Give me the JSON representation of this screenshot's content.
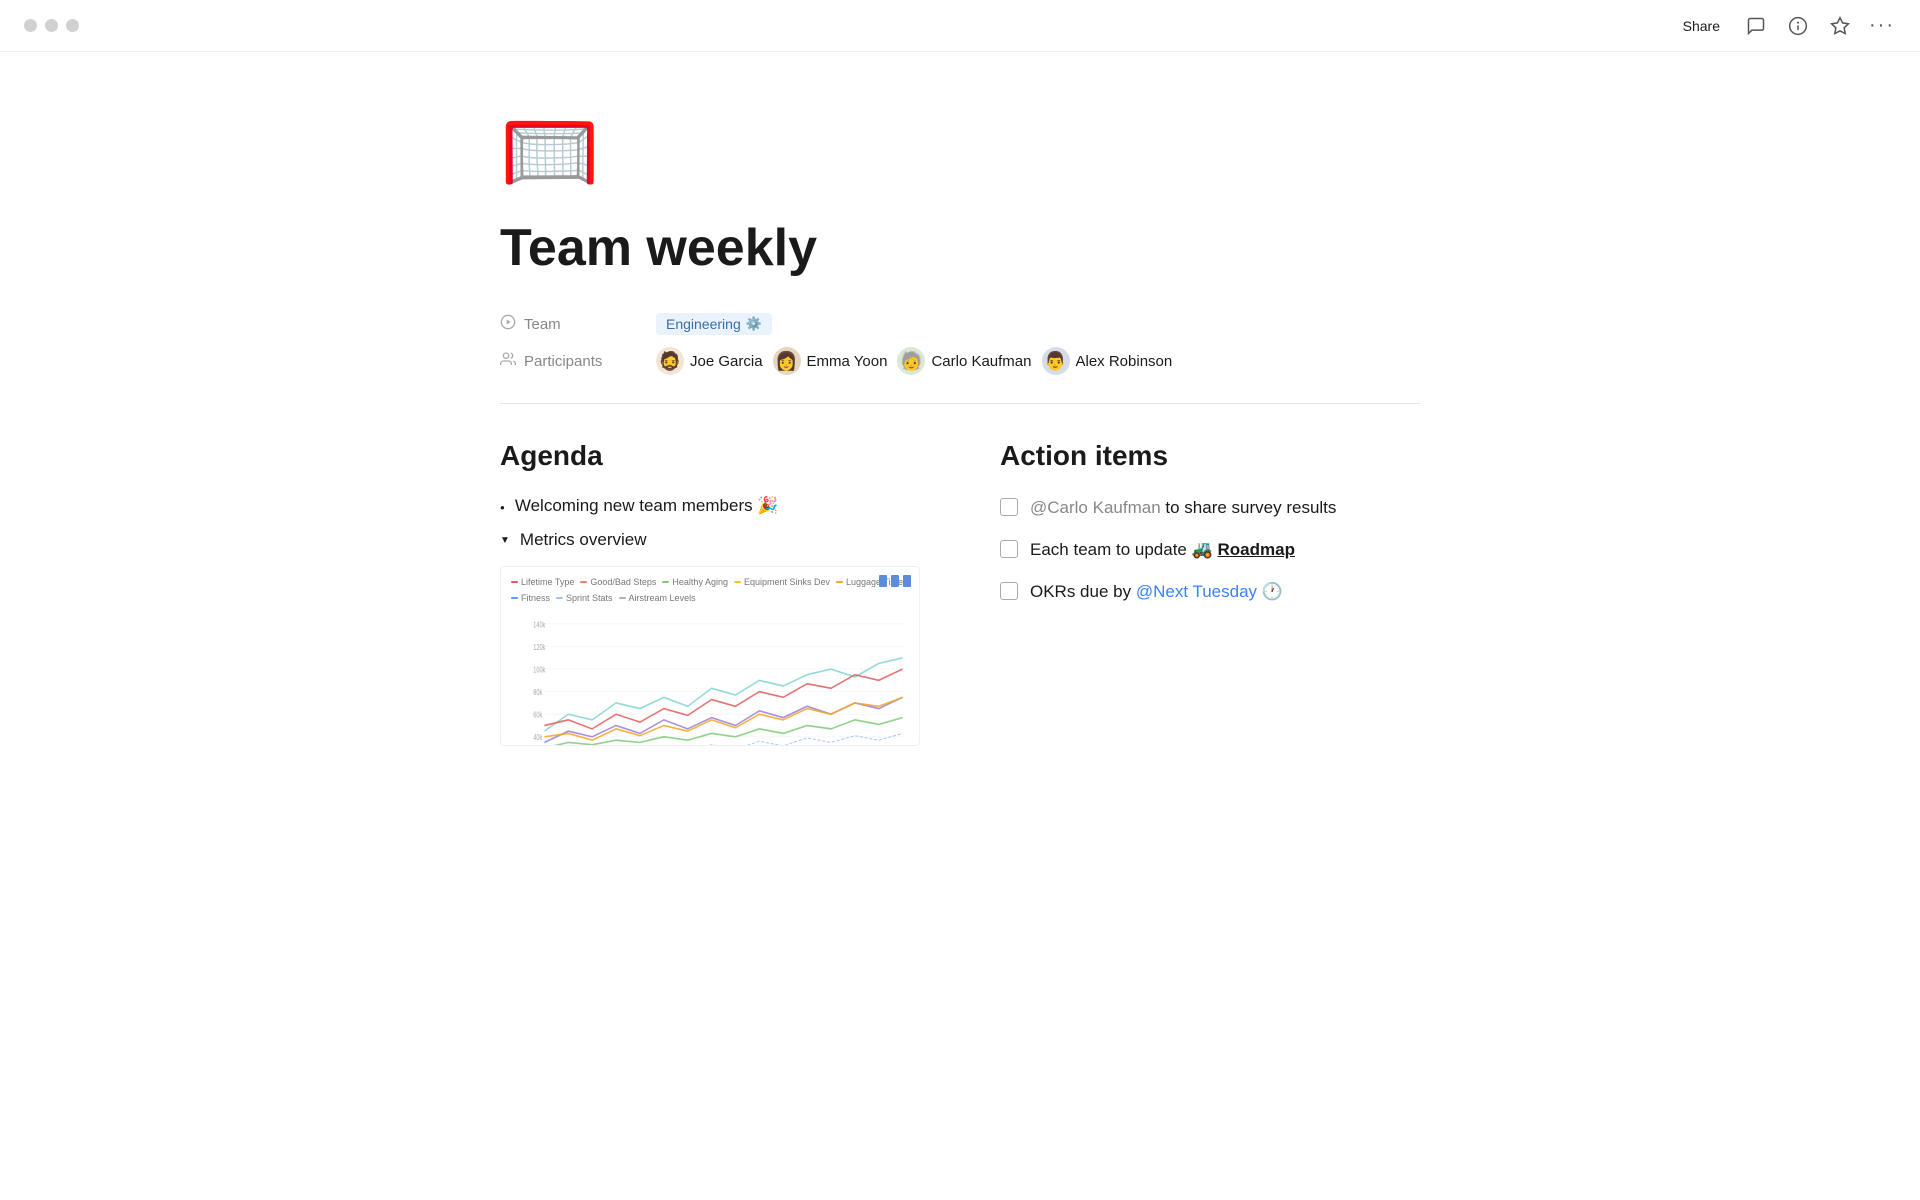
{
  "titlebar": {
    "share_label": "Share",
    "more_label": "···"
  },
  "page": {
    "icon": "🥅",
    "title": "Team weekly"
  },
  "properties": {
    "team_label": "Team",
    "team_value": "Engineering",
    "team_gear": "⚙️",
    "participants_label": "Participants",
    "participants": [
      {
        "name": "Joe Garcia",
        "emoji": "🧑"
      },
      {
        "name": "Emma Yoon",
        "emoji": "👩"
      },
      {
        "name": "Carlo Kaufman",
        "emoji": "🧓"
      },
      {
        "name": "Alex Robinson",
        "emoji": "👨"
      }
    ]
  },
  "agenda": {
    "title": "Agenda",
    "items": [
      {
        "type": "bullet",
        "text": "Welcoming new team members 🎉"
      },
      {
        "type": "triangle",
        "text": "Metrics overview"
      }
    ]
  },
  "action_items": {
    "title": "Action items",
    "items": [
      {
        "mention": "@Carlo Kaufman",
        "text_after": " to share survey results",
        "emoji": "",
        "link": "",
        "link_text": ""
      },
      {
        "mention": "",
        "text_before": "Each team to update ",
        "emoji": "🚜",
        "link": "Roadmap",
        "text_after": ""
      },
      {
        "mention": "",
        "text_before": "OKRs due by ",
        "date_link": "@Next Tuesday",
        "emoji_after": "🕐"
      }
    ]
  },
  "chart": {
    "legend": [
      {
        "label": "Lifetime Type",
        "color": "#e05c5c"
      },
      {
        "label": "Good/Bad Steps",
        "color": "#e05c5c"
      },
      {
        "label": "Healthy Aging",
        "color": "#82c97a"
      },
      {
        "label": "Equipment Sinks Dev",
        "color": "#f5c518"
      },
      {
        "label": "Luggage Time",
        "color": "#f5c518"
      },
      {
        "label": "Fitness",
        "color": "#5b9cf0"
      },
      {
        "label": "Sprint Stats",
        "color": "#a0c0f0"
      },
      {
        "label": "Airstream Levels",
        "color": "#c0c0c0"
      }
    ]
  },
  "icons": {
    "traffic_lights": [
      "#c0c0c0",
      "#c0c0c0",
      "#c0c0c0"
    ],
    "comment": "💬",
    "info": "ⓘ",
    "star": "☆",
    "more": "···",
    "team_prop_icon": "⊙",
    "participants_icon": "👥"
  }
}
